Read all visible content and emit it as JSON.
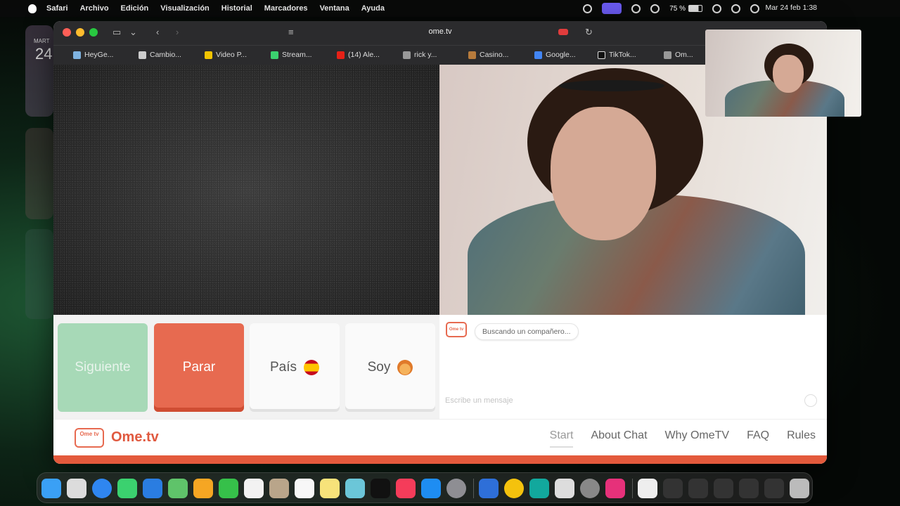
{
  "menubar": {
    "app": "Safari",
    "items": [
      "Archivo",
      "Edición",
      "Visualización",
      "Historial",
      "Marcadores",
      "Ventana",
      "Ayuda"
    ],
    "battery": "75 %",
    "clock": "Mar 24 feb 1:38"
  },
  "widgets": {
    "calendar_day": "24",
    "calendar_month": "MART"
  },
  "browser": {
    "url": "ome.tv",
    "bookmarks": [
      "HeyGe...",
      "Cambio...",
      "Video P...",
      "Stream...",
      "(14) Ale...",
      "rick y...",
      "Casino...",
      "Google...",
      "TikTok...",
      "Om..."
    ]
  },
  "controls": {
    "next": "Siguiente",
    "stop": "Parar",
    "country": "País",
    "gender": "Soy"
  },
  "chat": {
    "status": "Buscando un compañero...",
    "placeholder": "Escribe un mensaje",
    "logo": "Ome tv"
  },
  "footer": {
    "logo_badge": "Ome tv",
    "brand": "Ome.tv",
    "nav": [
      "Start",
      "About Chat",
      "Why OmeTV",
      "FAQ",
      "Rules"
    ]
  },
  "colors": {
    "brand": "#e35a3c",
    "next_button": "#a7d9b7",
    "stop_button": "#e76a50"
  }
}
